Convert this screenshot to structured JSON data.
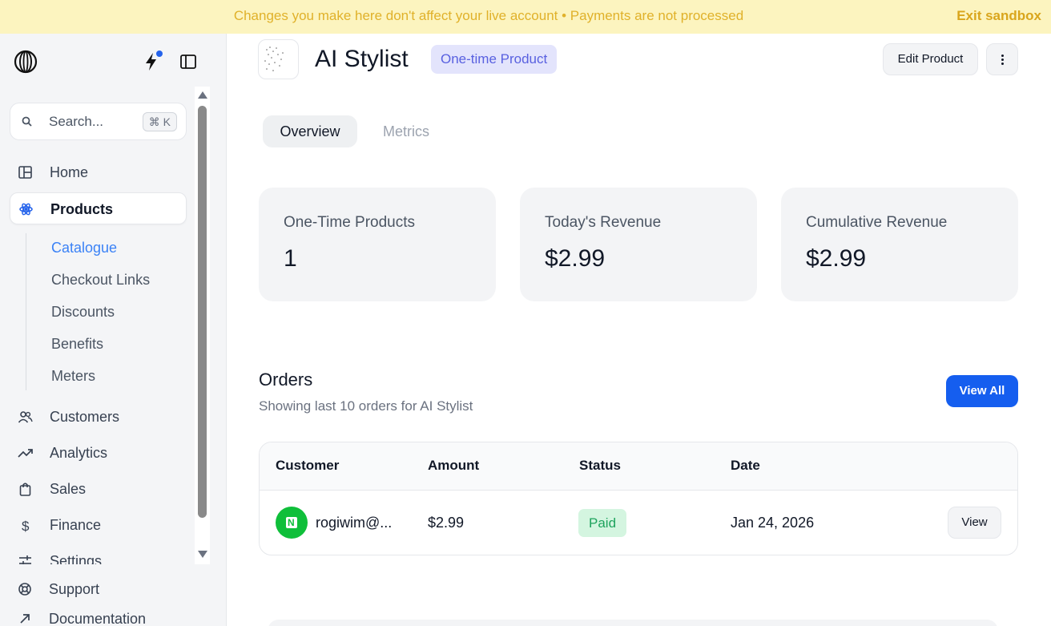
{
  "banner": {
    "message": "Changes you make here don't affect your live account • Payments are not processed",
    "exit_label": "Exit sandbox"
  },
  "sidebar": {
    "search": {
      "placeholder": "Search...",
      "shortcut": "⌘ K"
    },
    "nav": [
      {
        "label": "Home",
        "icon": "layout-icon"
      },
      {
        "label": "Products",
        "icon": "box-icon",
        "active": true
      },
      {
        "label": "Customers",
        "icon": "users-icon"
      },
      {
        "label": "Analytics",
        "icon": "trending-up-icon"
      },
      {
        "label": "Sales",
        "icon": "shopping-bag-icon"
      },
      {
        "label": "Finance",
        "icon": "dollar-icon"
      },
      {
        "label": "Settings",
        "icon": "sliders-icon"
      }
    ],
    "subnav": [
      {
        "label": "Catalogue",
        "active": true
      },
      {
        "label": "Checkout Links"
      },
      {
        "label": "Discounts"
      },
      {
        "label": "Benefits"
      },
      {
        "label": "Meters"
      }
    ],
    "footer": [
      {
        "label": "Support",
        "icon": "lifebuoy-icon"
      },
      {
        "label": "Documentation",
        "icon": "arrow-up-right-icon"
      }
    ],
    "accent_color": "#3b82f6"
  },
  "product": {
    "title": "AI Stylist",
    "type_badge": "One-time Product",
    "edit_label": "Edit Product"
  },
  "tabs": [
    {
      "label": "Overview",
      "active": true
    },
    {
      "label": "Metrics"
    }
  ],
  "stats": [
    {
      "label": "One-Time Products",
      "value": "1"
    },
    {
      "label": "Today's Revenue",
      "value": "$2.99"
    },
    {
      "label": "Cumulative Revenue",
      "value": "$2.99"
    }
  ],
  "orders": {
    "title": "Orders",
    "subtitle": "Showing last 10 orders for AI Stylist",
    "view_all_label": "View All",
    "columns": [
      "Customer",
      "Amount",
      "Status",
      "Date"
    ],
    "rows": [
      {
        "customer": "rogiwim@...",
        "avatar_letter": "N",
        "amount": "$2.99",
        "status": "Paid",
        "date": "Jan 24, 2026",
        "action": "View"
      }
    ]
  },
  "colors": {
    "primary_button": "#155eef",
    "banner_bg": "#fcf4bf",
    "banner_text": "#e0b12a",
    "paid_bg": "#d4f5e0",
    "paid_text": "#1ea35d",
    "badge_bg": "#e3e4fc",
    "badge_text": "#5961e0"
  }
}
